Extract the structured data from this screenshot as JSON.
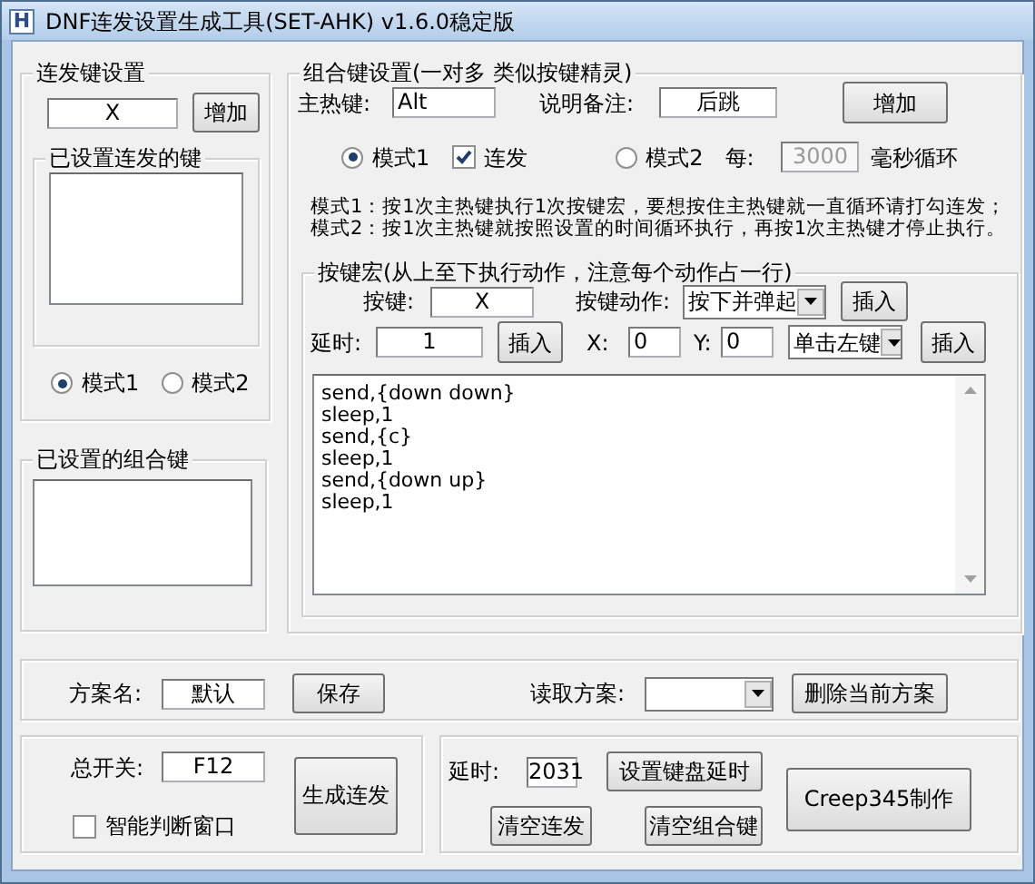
{
  "window": {
    "icon_text": "H",
    "title": "DNF连发设置生成工具(SET-AHK) v1.6.0稳定版"
  },
  "repeat_keys": {
    "title": "连发键设置",
    "key_value": "X",
    "add_button": "增加",
    "list_title": "已设置连发的键",
    "modes": [
      {
        "label": "模式1",
        "selected": true
      },
      {
        "label": "模式2",
        "selected": false
      }
    ]
  },
  "combo_list": {
    "title": "已设置的组合键"
  },
  "combo_settings": {
    "title": "组合键设置(一对多 类似按键精灵)",
    "hotkey_label": "主热键:",
    "hotkey_value": "Alt",
    "note_label": "说明备注:",
    "note_value": "后跳",
    "add_button": "增加",
    "mode1": {
      "label": "模式1",
      "selected": true
    },
    "repeat": {
      "label": "连发",
      "checked": true
    },
    "mode2": {
      "label": "模式2",
      "selected": false
    },
    "interval_label": "每:",
    "interval_value": "3000",
    "interval_disabled": true,
    "interval_unit": "毫秒循环",
    "help": [
      "模式1：按1次主热键执行1次按键宏，要想按住主热键就一直循环请打勾连发；",
      "模式2：按1次主热键就按照设置的时间循环执行，再按1次主热键才停止执行。"
    ],
    "macro": {
      "title": "按键宏(从上至下执行动作，注意每个动作占一行)",
      "key_label": "按键:",
      "key_value": "X",
      "action_label": "按键动作:",
      "action_value": "按下并弹起",
      "insert_key_button": "插入",
      "delay_label": "延时:",
      "delay_value": "1",
      "insert_delay_button": "插入",
      "x_label": "X:",
      "x_value": "0",
      "y_label": "Y:",
      "y_value": "0",
      "click_value": "单击左键",
      "insert_click_button": "插入",
      "lines": [
        "send,{down down}",
        "sleep,1",
        "send,{c}",
        "sleep,1",
        "send,{down up}",
        "sleep,1"
      ]
    }
  },
  "scheme": {
    "name_label": "方案名:",
    "name_value": "默认",
    "save_button": "保存",
    "load_label": "读取方案:",
    "delete_button": "删除当前方案"
  },
  "master": {
    "switch_label": "总开关:",
    "switch_value": "F12",
    "generate_button": "生成连发",
    "smart_window": {
      "label": "智能判断窗口",
      "checked": false
    }
  },
  "tools": {
    "delay_label": "延时:",
    "delay_value": "2031",
    "set_delay_button": "设置键盘延时",
    "clear_repeat_button": "清空连发",
    "clear_combo_button": "清空组合键",
    "credit_button": "Creep345制作"
  }
}
